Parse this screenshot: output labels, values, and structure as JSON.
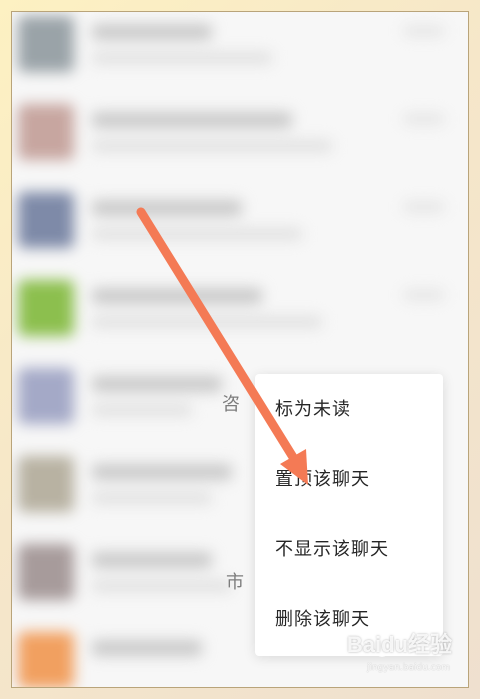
{
  "context_menu": {
    "items": [
      {
        "label": "标为未读"
      },
      {
        "label": "置顶该聊天"
      },
      {
        "label": "不显示该聊天"
      },
      {
        "label": "删除该聊天"
      }
    ]
  },
  "peek_text": {
    "left_char_1": "咨",
    "left_char_2": "市"
  },
  "watermark": {
    "brand": "Baidu经验",
    "url": "jingyan.baidu.com"
  },
  "colors": {
    "arrow": "#f47a55",
    "menu_bg": "#ffffff",
    "frame": "#f6e7c9"
  },
  "icons": {
    "annotation": "arrow-pointer-icon",
    "watermark_logo": "baidu-paw-icon"
  }
}
